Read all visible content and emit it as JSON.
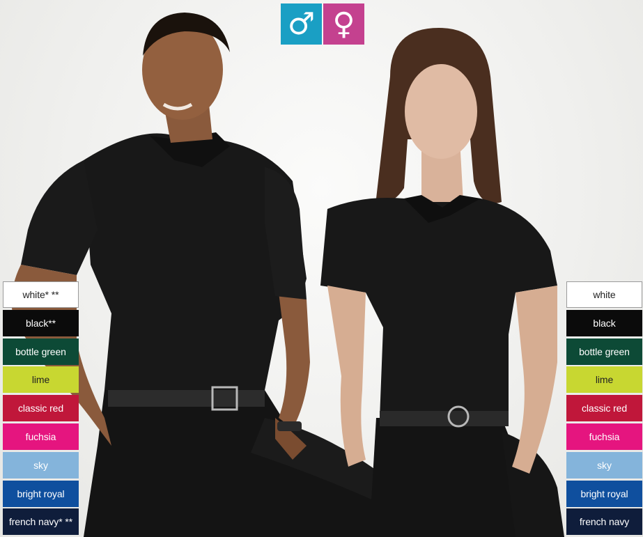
{
  "gender_icons": {
    "male": {
      "symbol": "♂",
      "color": "#1a9fc4"
    },
    "female": {
      "symbol": "♀",
      "color": "#c4418f"
    }
  },
  "left_colors": [
    {
      "label": "white* **",
      "color": "#ffffff",
      "text_color": "#222222"
    },
    {
      "label": "black**",
      "color": "#0b0b0b",
      "text_color": "#ffffff"
    },
    {
      "label": "bottle green",
      "color": "#0d4a36",
      "text_color": "#ffffff"
    },
    {
      "label": "lime",
      "color": "#c8d731",
      "text_color": "#222222"
    },
    {
      "label": "classic red",
      "color": "#c0173a",
      "text_color": "#ffffff"
    },
    {
      "label": "fuchsia",
      "color": "#e5157f",
      "text_color": "#ffffff"
    },
    {
      "label": "sky",
      "color": "#84b4db",
      "text_color": "#ffffff"
    },
    {
      "label": "bright royal",
      "color": "#0f4f9e",
      "text_color": "#ffffff"
    },
    {
      "label": "french navy* **",
      "color": "#0f1d3b",
      "text_color": "#ffffff"
    }
  ],
  "right_colors": [
    {
      "label": "white",
      "color": "#ffffff",
      "text_color": "#222222"
    },
    {
      "label": "black",
      "color": "#0b0b0b",
      "text_color": "#ffffff"
    },
    {
      "label": "bottle green",
      "color": "#0d4a36",
      "text_color": "#ffffff"
    },
    {
      "label": "lime",
      "color": "#c8d731",
      "text_color": "#222222"
    },
    {
      "label": "classic red",
      "color": "#c0173a",
      "text_color": "#ffffff"
    },
    {
      "label": "fuchsia",
      "color": "#e5157f",
      "text_color": "#ffffff"
    },
    {
      "label": "sky",
      "color": "#84b4db",
      "text_color": "#ffffff"
    },
    {
      "label": "bright royal",
      "color": "#0f4f9e",
      "text_color": "#ffffff"
    },
    {
      "label": "french navy",
      "color": "#0f1d3b",
      "text_color": "#ffffff"
    }
  ]
}
